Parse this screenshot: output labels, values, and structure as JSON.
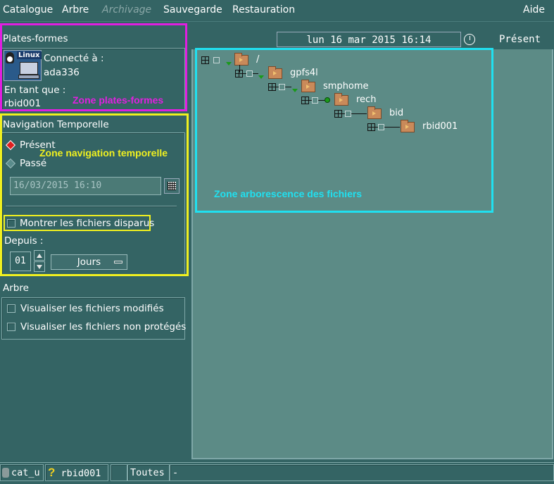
{
  "menu": {
    "catalogue": "Catalogue",
    "arbre": "Arbre",
    "archivage": "Archivage",
    "sauvegarde": "Sauvegarde",
    "restauration": "Restauration",
    "aide": "Aide"
  },
  "platforms": {
    "title": "Plates-formes",
    "os_badge": "Linux",
    "connected_label": "Connecté à :",
    "host": "ada336",
    "as_label": "En tant que :",
    "user": "rbid001",
    "zone_label": "Zone plates-formes"
  },
  "time_nav": {
    "title": "Navigation Temporelle",
    "present_label": "Présent",
    "past_label": "Passé",
    "selected": "present",
    "date_value": "16/03/2015 16:10",
    "show_deleted_label": "Montrer les fichiers disparus",
    "since_label": "Depuis :",
    "since_value": "01",
    "unit_value": "Jours",
    "zone_label": "Zone navigation temporelle"
  },
  "tree_options": {
    "title": "Arbre",
    "show_modified_label": "Visualiser les fichiers modifiés",
    "show_unprotected_label": "Visualiser les fichiers non protégés"
  },
  "file_tree": {
    "current_date": "lun 16 mar 2015 16:14",
    "mode_label": "Présent",
    "nodes": [
      {
        "name": "/"
      },
      {
        "name": "gpfs4l"
      },
      {
        "name": "smphome"
      },
      {
        "name": "rech"
      },
      {
        "name": "bid"
      },
      {
        "name": "rbid001"
      }
    ],
    "zone_label": "Zone arborescence des fichiers"
  },
  "statusbar": {
    "catalog": "cat_u",
    "help_glyph": "?",
    "user": "rbid001",
    "filter": "Toutes",
    "extra": "-"
  },
  "colors": {
    "background": "#346464",
    "tree_panel": "#5c8b86",
    "zone_platforms": "#e01ee0",
    "zone_time_nav": "#f0f020",
    "zone_tree": "#20e0f0"
  }
}
